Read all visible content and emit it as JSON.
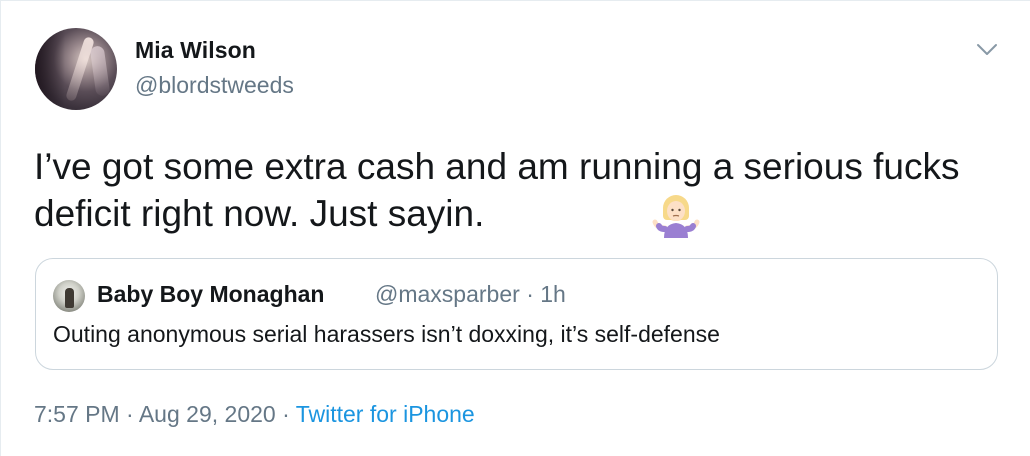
{
  "tweet": {
    "author_name": "Mia Wilson",
    "author_handle": "@blordstweeds",
    "text": "I’ve got some extra cash and am running a serious fucks deficit right now. Just sayin.",
    "emoji": "person-shrugging-emoji",
    "menu_icon": "chevron-down-icon",
    "time": "7:57 PM",
    "date": "Aug 29, 2020",
    "source": "Twitter for iPhone",
    "separator": "·"
  },
  "quoted": {
    "author_name": "Baby Boy Monaghan",
    "author_handle": "@maxsparber",
    "separator": "·",
    "age": "1h",
    "text": "Outing anonymous serial harassers isn’t doxxing, it’s self-defense"
  },
  "colors": {
    "text": "#14171a",
    "secondary": "#657786",
    "link": "#1b95e0",
    "border": "#ccd6dd"
  }
}
